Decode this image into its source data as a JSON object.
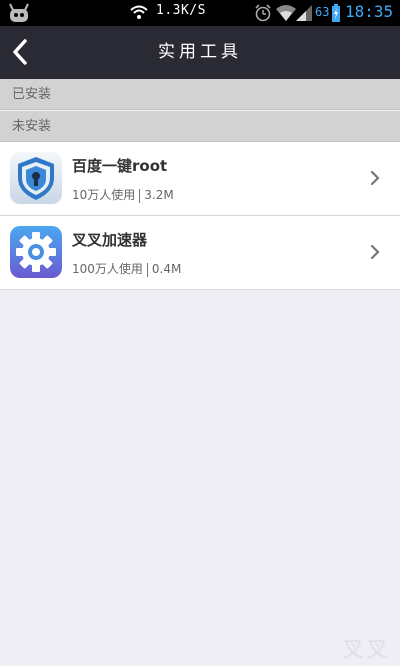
{
  "status_bar": {
    "net_speed": "1.3K/S",
    "battery_percent": "63",
    "time": "18:35",
    "icons": [
      "android-icon",
      "wifi-icon",
      "alarm-icon",
      "wifi-icon",
      "signal-icon",
      "battery-charging-icon"
    ]
  },
  "nav": {
    "title": "实用工具",
    "back_icon": "chevron-left-icon"
  },
  "sections": {
    "installed": "已安装",
    "not_installed": "未安装"
  },
  "apps": [
    {
      "name": "百度一键root",
      "users": "10万人使用",
      "size": "3.2M",
      "icon": "shield-lock-icon"
    },
    {
      "name": "叉叉加速器",
      "users": "100万人使用",
      "size": "0.4M",
      "icon": "gear-icon"
    }
  ],
  "watermark": "叉叉",
  "colors": {
    "navbar": "#2a2a35",
    "status_accent": "#3fa9f5",
    "page_bg": "#efeef4"
  }
}
